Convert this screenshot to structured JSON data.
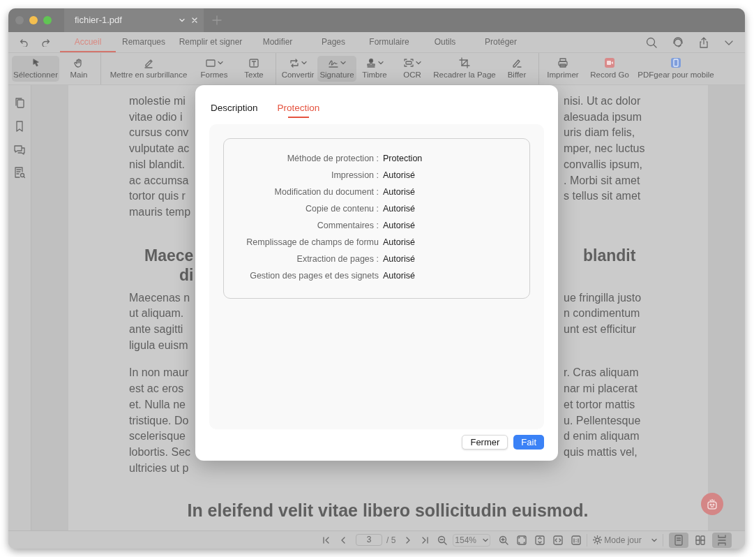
{
  "window": {
    "tab_title": "fichier-1.pdf"
  },
  "menu_tabs": [
    {
      "label": "Accueil",
      "selected": true
    },
    {
      "label": "Remarques",
      "selected": false
    },
    {
      "label": "Remplir et signer",
      "selected": false
    },
    {
      "label": "Modifier",
      "selected": false
    },
    {
      "label": "Pages",
      "selected": false
    },
    {
      "label": "Formulaire",
      "selected": false
    },
    {
      "label": "Outils",
      "selected": false
    },
    {
      "label": "Protéger",
      "selected": false
    }
  ],
  "toolbar_groups": [
    [
      {
        "label": "Sélectionner",
        "selected": true,
        "dropdown": false
      },
      {
        "label": "Main",
        "selected": false,
        "dropdown": false
      }
    ],
    [
      {
        "label": "Mettre en surbrillance",
        "selected": false,
        "dropdown": false
      },
      {
        "label": "Formes",
        "selected": false,
        "dropdown": true
      },
      {
        "label": "Texte",
        "selected": false,
        "dropdown": false
      }
    ],
    [
      {
        "label": "Convertir",
        "selected": false,
        "dropdown": true
      },
      {
        "label": "Signature",
        "selected": true,
        "dropdown": true
      },
      {
        "label": "Timbre",
        "selected": false,
        "dropdown": true
      },
      {
        "label": "OCR",
        "selected": false,
        "dropdown": true
      },
      {
        "label": "Recadrer la Page",
        "selected": false,
        "dropdown": false
      },
      {
        "label": "Biffer",
        "selected": false,
        "dropdown": false
      }
    ],
    [
      {
        "label": "Imprimer",
        "selected": false,
        "dropdown": false
      },
      {
        "label": "Record Go",
        "selected": false,
        "dropdown": false
      },
      {
        "label": "PDFgear pour mobile",
        "selected": false,
        "dropdown": false
      }
    ]
  ],
  "document": [
    {
      "kind": "paragraph",
      "lines": [
        {
          "left": "molestie mi",
          "right": "nisi. Ut ac dolor"
        },
        {
          "left": "vitae odio i",
          "right": "alesuada ipsum"
        },
        {
          "left": "cursus conv",
          "right": "uris diam felis,"
        },
        {
          "left": "vulputate ac",
          "right": "mper, nec luctus"
        },
        {
          "left": "nisl blandit.",
          "right": "convallis ipsum,"
        },
        {
          "left": "ac accumsa",
          "right": ". Morbi sit amet"
        },
        {
          "left": "tortor quis r",
          "right": "s tellus sit amet"
        },
        {
          "left": "mauris temp"
        }
      ]
    },
    {
      "kind": "heading",
      "lines": [
        {
          "left": "Maece",
          "right": "blandit"
        },
        {
          "left": "di"
        }
      ]
    },
    {
      "kind": "paragraph",
      "lines": [
        {
          "left": "Maecenas n",
          "right": "ue fringilla justo"
        },
        {
          "left": "ut aliquam.",
          "right": "n condimentum"
        },
        {
          "left": "ante sagitti",
          "right": "unt est efficitur"
        },
        {
          "left": "ligula euism"
        }
      ]
    },
    {
      "kind": "paragraph",
      "lines": [
        {
          "left": "In non maur",
          "right": "r. Cras aliquam"
        },
        {
          "left": "est ac eros",
          "right": "nar mi placerat"
        },
        {
          "left": "et. Nulla ne",
          "right": "et tortor mattis"
        },
        {
          "left": "tristique. Do",
          "right": "u. Pellentesque"
        },
        {
          "left": "scelerisque",
          "right": "d enim aliquam"
        },
        {
          "left": "lobortis. Sec",
          "right": "quis mattis vel,"
        },
        {
          "left": "ultricies ut p"
        }
      ]
    },
    {
      "kind": "title",
      "lines": [
        {
          "left": "In eleifend velit vitae libero sollicitudin euismod."
        }
      ]
    }
  ],
  "dialog": {
    "tabs": [
      {
        "label": "Description",
        "selected": false
      },
      {
        "label": "Protection",
        "selected": true
      }
    ],
    "rows": [
      {
        "label": "Méthode de protection :",
        "value": "Protection"
      },
      {
        "label": "Impression :",
        "value": "Autorisé"
      },
      {
        "label": "Modification du document :",
        "value": "Autorisé"
      },
      {
        "label": "Copie de contenu :",
        "value": "Autorisé"
      },
      {
        "label": "Commentaires :",
        "value": "Autorisé"
      },
      {
        "label": "Remplissage de champs de formu",
        "value": "Autorisé"
      },
      {
        "label": "Extraction de pages :",
        "value": "Autorisé"
      },
      {
        "label": "Gestion des pages et des signets",
        "value": "Autorisé"
      }
    ],
    "buttons": [
      {
        "label": "Fermer",
        "primary": false
      },
      {
        "label": "Fait",
        "primary": true
      }
    ]
  },
  "status_bar": {
    "page": "3",
    "page_total": "/ 5",
    "zoom": "154%",
    "mode": "Mode jour",
    "views": [
      {
        "selected": true
      },
      {
        "selected": false
      },
      {
        "selected": true
      }
    ]
  }
}
